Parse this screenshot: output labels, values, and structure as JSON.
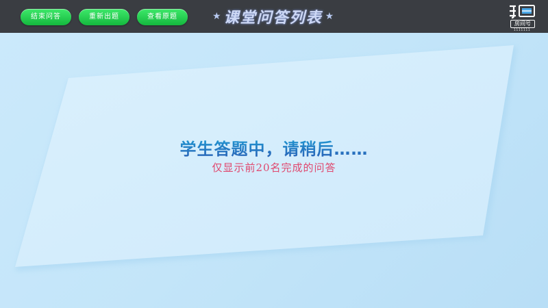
{
  "toolbar": {
    "buttons": [
      {
        "label": "结束问答"
      },
      {
        "label": "重新出题"
      },
      {
        "label": "查看原题"
      }
    ]
  },
  "header": {
    "title": "课堂问答列表",
    "star_icon": "star-icon"
  },
  "logo": {
    "icon": "douyu-logo",
    "room_label": "房间号",
    "room_number": "1111111"
  },
  "main": {
    "status_text": "学生答题中，请稍后……",
    "note_text": "仅显示前20名完成的问答"
  },
  "colors": {
    "topbar_bg": "#3a3d42",
    "button_green": "#20c24a",
    "background_blue": "#bfe2f7",
    "panel_light": "#d6eefc",
    "status_text_blue": "#2b7fc4",
    "note_text_pink": "#e0486e"
  }
}
